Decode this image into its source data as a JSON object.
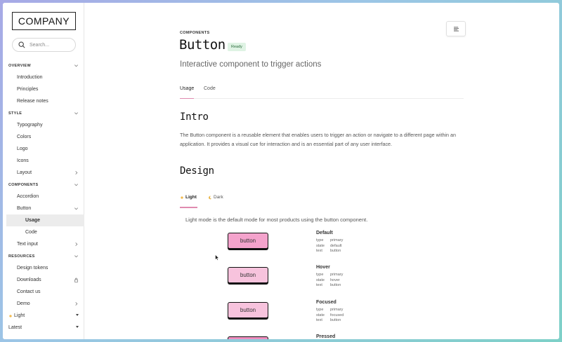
{
  "brand": {
    "logo": "COMPANY"
  },
  "search": {
    "placeholder": "Search..."
  },
  "sidebar": {
    "sections": [
      {
        "label": "OVERVIEW",
        "items": [
          {
            "label": "Introduction"
          },
          {
            "label": "Principles"
          },
          {
            "label": "Release notes"
          }
        ]
      },
      {
        "label": "STYLE",
        "items": [
          {
            "label": "Typography"
          },
          {
            "label": "Colors"
          },
          {
            "label": "Logo"
          },
          {
            "label": "Icons"
          },
          {
            "label": "Layout"
          }
        ]
      },
      {
        "label": "COMPONENTS",
        "items": [
          {
            "label": "Accordion"
          },
          {
            "label": "Button",
            "children": [
              {
                "label": "Usage"
              },
              {
                "label": "Code"
              }
            ]
          },
          {
            "label": "Text input"
          }
        ]
      },
      {
        "label": "RESOURCES",
        "items": [
          {
            "label": "Design tokens"
          },
          {
            "label": "Downloads"
          },
          {
            "label": "Contact us"
          },
          {
            "label": "Demo"
          }
        ]
      }
    ],
    "footer": {
      "theme_label": "Light",
      "version_label": "Latest"
    }
  },
  "page": {
    "eyebrow": "COMPONENTS",
    "title": "Button",
    "status_badge": "Ready",
    "subtitle": "Interactive component to trigger actions",
    "tabs": [
      {
        "label": "Usage",
        "active": true
      },
      {
        "label": "Code",
        "active": false
      }
    ],
    "intro_heading": "Intro",
    "intro_text": "The Button component is a reusable element that enables users to trigger an action or navigate to a different page within an application. It provides a visual cue for interaction and is an essential part of any user interface.",
    "design_heading": "Design",
    "modes": [
      {
        "label": "Light",
        "active": true
      },
      {
        "label": "Dark",
        "active": false
      }
    ],
    "mode_description": "Light mode is the default mode for most products using the button component.",
    "states": [
      {
        "name": "Default",
        "button_label": "button",
        "color": "#f4a3cc",
        "props": {
          "type": "primary",
          "state": "default",
          "text": "button"
        }
      },
      {
        "name": "Hover",
        "button_label": "button",
        "color": "#f7c3dd",
        "props": {
          "type": "primary",
          "state": "hover",
          "text": "button"
        }
      },
      {
        "name": "Focused",
        "button_label": "button",
        "color": "#f7c3dd",
        "props": {
          "type": "primary",
          "state": "focused",
          "text": "button"
        }
      },
      {
        "name": "Pressed",
        "button_label": "",
        "color": "#f08fc0",
        "props": {}
      }
    ]
  },
  "colors": {
    "accent": "#e08bb0",
    "badge_bg": "#dff3e4",
    "badge_text": "#2a6b3a"
  }
}
